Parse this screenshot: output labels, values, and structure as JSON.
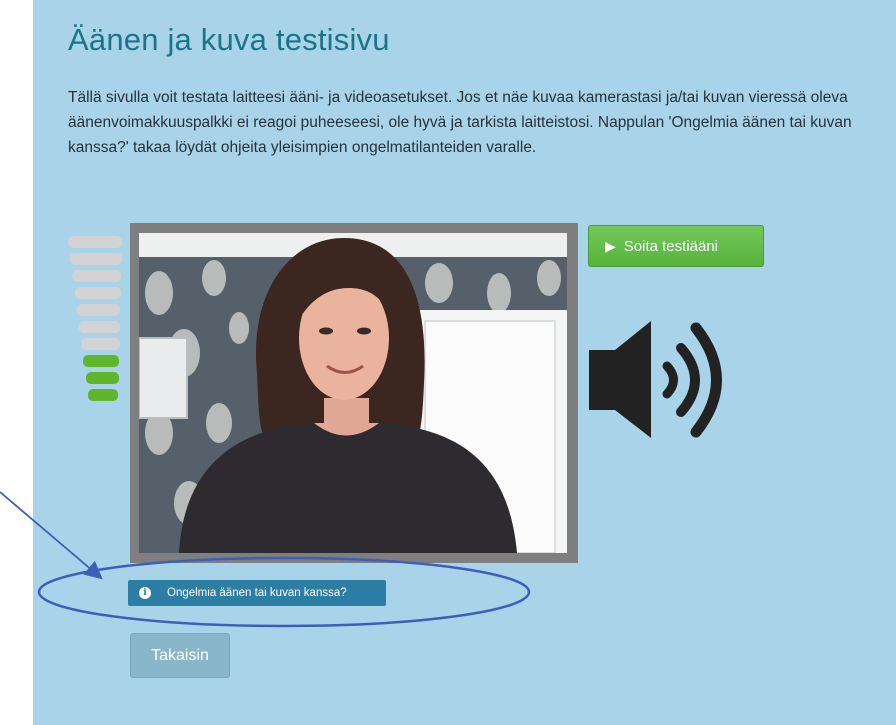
{
  "page": {
    "title": "Äänen ja kuva testisivu",
    "description": "Tällä sivulla voit testata laitteesi ääni- ja videoasetukset. Jos et näe kuvaa kamerastasi ja/tai kuvan vieressä oleva äänenvoimakkuuspalkki ei reagoi puheeseesi, ole hyvä ja tarkista laitteistosi. Nappulan 'Ongelmia äänen tai kuvan kanssa?' takaa löydät ohjeita yleisimpien ongelmatilanteiden varalle."
  },
  "volume_meter": {
    "total_bars": 10,
    "active_bars": 3,
    "active_color": "#5fb52b",
    "inactive_color": "#d3d3d3"
  },
  "buttons": {
    "play_test_sound": "Soita testiääni",
    "play_icon": "play-triangle-icon",
    "problems": "Ongelmia äänen tai kuvan kanssa?",
    "problems_icon": "info-icon",
    "back": "Takaisin"
  },
  "colors": {
    "page_bg": "#a9d3e8",
    "title": "#1a7588",
    "green_button": "#5eb843",
    "blue_button": "#2d7ea4",
    "back_button": "#8ab6c9",
    "annotation": "#3d5fb8"
  },
  "icons": {
    "speaker": "speaker-volume-icon",
    "camera": "webcam-preview"
  }
}
